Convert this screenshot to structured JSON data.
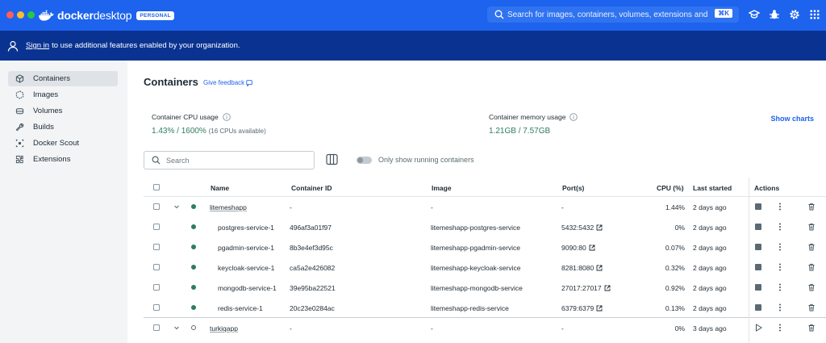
{
  "titlebar": {
    "brand_docker": "docker",
    "brand_desktop": "desktop",
    "badge": "PERSONAL",
    "search_placeholder": "Search for images, containers, volumes, extensions and mor...",
    "shortcut": "⌘K",
    "accent": "#1d63ed"
  },
  "banner": {
    "signin": "Sign in",
    "text": "to use additional features enabled by your organization."
  },
  "sidebar": {
    "items": [
      {
        "label": "Containers",
        "icon": "container-icon",
        "active": true
      },
      {
        "label": "Images",
        "icon": "image-icon"
      },
      {
        "label": "Volumes",
        "icon": "volume-icon"
      },
      {
        "label": "Builds",
        "icon": "build-icon"
      },
      {
        "label": "Docker Scout",
        "icon": "scout-icon"
      },
      {
        "label": "Extensions",
        "icon": "extensions-icon"
      }
    ]
  },
  "main": {
    "title": "Containers",
    "feedback": "Give feedback",
    "cpu_label": "Container CPU usage",
    "cpu_value": "1.43% / 1600%",
    "cpu_sub": "(16 CPUs available)",
    "mem_label": "Container memory usage",
    "mem_value": "1.21GB / 7.57GB",
    "show_charts": "Show charts",
    "search_placeholder": "Search",
    "toggle_label": "Only show running containers"
  },
  "table": {
    "headers": {
      "name": "Name",
      "container_id": "Container ID",
      "image": "Image",
      "ports": "Port(s)",
      "cpu": "CPU (%)",
      "last_started": "Last started",
      "actions": "Actions"
    },
    "rows": [
      {
        "name": "litemeshapp",
        "id": "-",
        "image": "-",
        "ports": "-",
        "cpu": "1.44%",
        "started": "2 days ago",
        "group": true,
        "running": true
      },
      {
        "name": "postgres-service-1",
        "id": "496af3a01f97",
        "image": "litemeshapp-postgres-service",
        "ports": "5432:5432",
        "cpu": "0%",
        "started": "2 days ago",
        "running": true
      },
      {
        "name": "pgadmin-service-1",
        "id": "8b3e4ef3d95c",
        "image": "litemeshapp-pgadmin-service",
        "ports": "9090:80",
        "cpu": "0.07%",
        "started": "2 days ago",
        "running": true
      },
      {
        "name": "keycloak-service-1",
        "id": "ca5a2e426082",
        "image": "litemeshapp-keycloak-service",
        "ports": "8281:8080",
        "cpu": "0.32%",
        "started": "2 days ago",
        "running": true
      },
      {
        "name": "mongodb-service-1",
        "id": "39e95ba22521",
        "image": "litemeshapp-mongodb-service",
        "ports": "27017:27017",
        "cpu": "0.92%",
        "started": "2 days ago",
        "running": true
      },
      {
        "name": "redis-service-1",
        "id": "20c23e0284ac",
        "image": "litemeshapp-redis-service",
        "ports": "6379:6379",
        "cpu": "0.13%",
        "started": "2 days ago",
        "running": true
      },
      {
        "name": "turkiqapp",
        "id": "-",
        "image": "-",
        "ports": "-",
        "cpu": "0%",
        "started": "3 days ago",
        "group": true,
        "running": false
      }
    ]
  }
}
